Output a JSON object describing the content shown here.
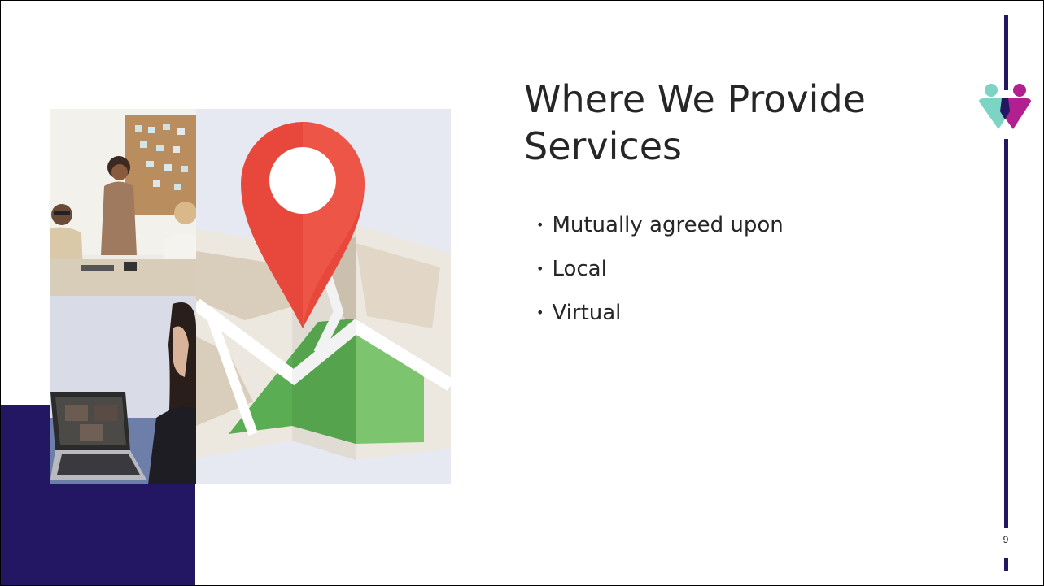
{
  "slide": {
    "title": "Where We Provide Services",
    "bullets": [
      "Mutually agreed upon",
      "Local",
      "Virtual"
    ],
    "page_number": "9"
  },
  "images": {
    "office_photo": "office-meeting-photo",
    "video_photo": "video-call-photo",
    "map": "map-location-pin-illustration",
    "logo": "people-logo-icon"
  },
  "colors": {
    "accent_purple": "#231764",
    "pin_red": "#e8473c",
    "map_green": "#5aad52",
    "logo_teal": "#7dd3c4",
    "logo_magenta": "#b21f8e"
  }
}
